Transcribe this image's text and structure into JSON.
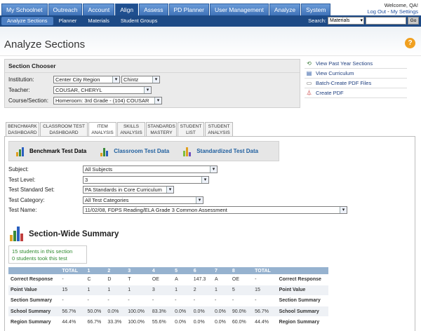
{
  "nav": {
    "tabs": [
      "My Schoolnet",
      "Outreach",
      "Account",
      "Align",
      "Assess",
      "PD Planner",
      "User Management",
      "Analyze",
      "System"
    ],
    "active": "Align"
  },
  "welcome": {
    "greeting": "Welcome, QA!",
    "logout": "Log Out",
    "separator": " - ",
    "settings": "My Settings"
  },
  "subnav": {
    "items": [
      "Analyze Sections",
      "Planner",
      "Materials",
      "Student Groups"
    ],
    "active": "Analyze Sections"
  },
  "search": {
    "label": "Search:",
    "scope": "Materials",
    "go": "Go"
  },
  "page": {
    "title": "Analyze Sections"
  },
  "chooser": {
    "heading": "Section Chooser",
    "institution_label": "Institution:",
    "institution_value": "Center City Region",
    "school_value": "Chintz",
    "teacher_label": "Teacher:",
    "teacher_value": "COUSAR, CHERYL",
    "course_label": "Course/Section:",
    "course_value": "Homeroom: 3rd Grade - (104) COUSAR"
  },
  "actions": [
    "View Past Year Sections",
    "View Curriculum",
    "Batch-Create PDF Files",
    "Create PDF"
  ],
  "report_tabs": [
    {
      "l1": "BENCHMARK",
      "l2": "DASHBOARD"
    },
    {
      "l1": "CLASSROOM TEST",
      "l2": "DASHBOARD"
    },
    {
      "l1": "ITEM",
      "l2": "ANALYSIS"
    },
    {
      "l1": "SKILLS",
      "l2": "ANALYSIS"
    },
    {
      "l1": "STANDARDS",
      "l2": "MASTERY"
    },
    {
      "l1": "STUDENT",
      "l2": "LIST"
    },
    {
      "l1": "STUDENT",
      "l2": "ANALYSIS"
    }
  ],
  "test_types": [
    "Benchmark Test Data",
    "Classroom Test Data",
    "Standardized Test Data"
  ],
  "filters": {
    "subject_label": "Subject:",
    "subject_value": "All Subjects",
    "level_label": "Test Level:",
    "level_value": "3",
    "standard_label": "Test Standard Set:",
    "standard_value": "PA Standards in Core Curriculum",
    "category_label": "Test Category:",
    "category_value": "All Test Categories",
    "name_label": "Test Name:",
    "name_value": "11/02/08, FDPS Reading/ELA Grade 3 Common Assessment"
  },
  "summary": {
    "title": "Section-Wide Summary",
    "students_in_section": "15 students in this section",
    "students_took": "0 students took this test"
  },
  "table": {
    "headers": [
      "",
      "TOTAL",
      "1",
      "2",
      "3",
      "4",
      "5",
      "6",
      "7",
      "8",
      "TOTAL",
      ""
    ],
    "rows": [
      [
        "Correct Response",
        "-",
        "C",
        "D",
        "T",
        "OE",
        "A",
        "147.3",
        "A",
        "OE",
        "-",
        "Correct Response"
      ],
      [
        "Point Value",
        "15",
        "1",
        "1",
        "1",
        "3",
        "1",
        "2",
        "1",
        "5",
        "15",
        "Point Value"
      ],
      [
        "Section Summary",
        "-",
        "-",
        "-",
        "-",
        "-",
        "-",
        "-",
        "-",
        "-",
        "-",
        "Section Summary"
      ],
      [
        "School Summary",
        "56.7%",
        "50.0%",
        "0.0%",
        "100.0%",
        "83.3%",
        "0.0%",
        "0.0%",
        "0.0%",
        "90.0%",
        "56.7%",
        "School Summary"
      ],
      [
        "Region Summary",
        "44.4%",
        "66.7%",
        "33.3%",
        "100.0%",
        "55.6%",
        "0.0%",
        "0.0%",
        "0.0%",
        "60.0%",
        "44.4%",
        "Region Summary"
      ]
    ]
  },
  "colors": {
    "nav_blue": "#3f72b8",
    "subbar": "#1d4a86",
    "table_header": "#96b2cf",
    "green_text": "#2e8a2e"
  }
}
